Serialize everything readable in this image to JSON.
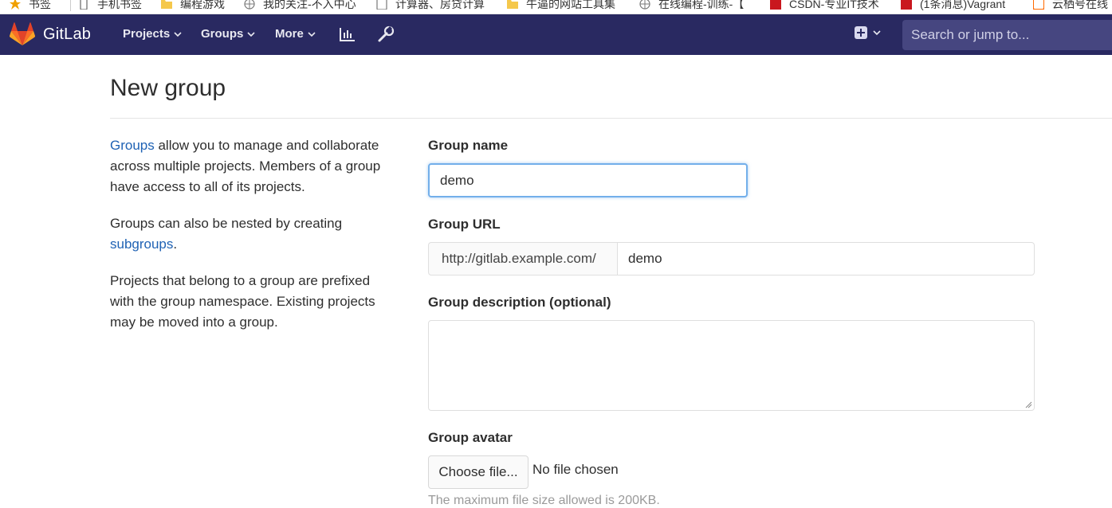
{
  "bookmarks": [
    {
      "label": "书签",
      "icon": "star-icon"
    },
    {
      "label": "手机书签",
      "icon": "phone-icon"
    },
    {
      "label": "编程游戏",
      "icon": "folder-icon"
    },
    {
      "label": "我的关注-不入中心",
      "icon": "globe-icon"
    },
    {
      "label": "计算器、房贷计算",
      "icon": "calculator-icon"
    },
    {
      "label": "牛逼的网站工具集",
      "icon": "folder-icon"
    },
    {
      "label": "在线编程-训练-【",
      "icon": "globe-icon"
    },
    {
      "label": "CSDN-专业IT技术",
      "icon": "csdn-icon"
    },
    {
      "label": "(1条消息)Vagrant",
      "icon": "csdn-icon"
    },
    {
      "label": "云栖号在线",
      "icon": "cloud-icon"
    }
  ],
  "navbar": {
    "logo_text": "GitLab",
    "items": [
      {
        "label": "Projects"
      },
      {
        "label": "Groups"
      },
      {
        "label": "More"
      }
    ],
    "search_placeholder": "Search or jump to..."
  },
  "page": {
    "title": "New group",
    "info": {
      "p1_link": "Groups",
      "p1_text": " allow you to manage and collaborate across multiple projects. Members of a group have access to all of its projects.",
      "p2_text": "Groups can also be nested by creating ",
      "p2_link": "subgroups",
      "p2_end": ".",
      "p3_text": "Projects that belong to a group are prefixed with the group namespace. Existing projects may be moved into a group."
    },
    "form": {
      "group_name_label": "Group name",
      "group_name_value": "demo",
      "group_url_label": "Group URL",
      "group_url_prefix": "http://gitlab.example.com/",
      "group_url_value": "demo",
      "description_label": "Group description (optional)",
      "description_value": "",
      "avatar_label": "Group avatar",
      "choose_file_label": "Choose file...",
      "file_status": "No file chosen",
      "file_help": "The maximum file size allowed is 200KB."
    }
  },
  "colors": {
    "navbar_bg": "#292961",
    "link": "#1f62b4",
    "focus_border": "#73afea"
  }
}
